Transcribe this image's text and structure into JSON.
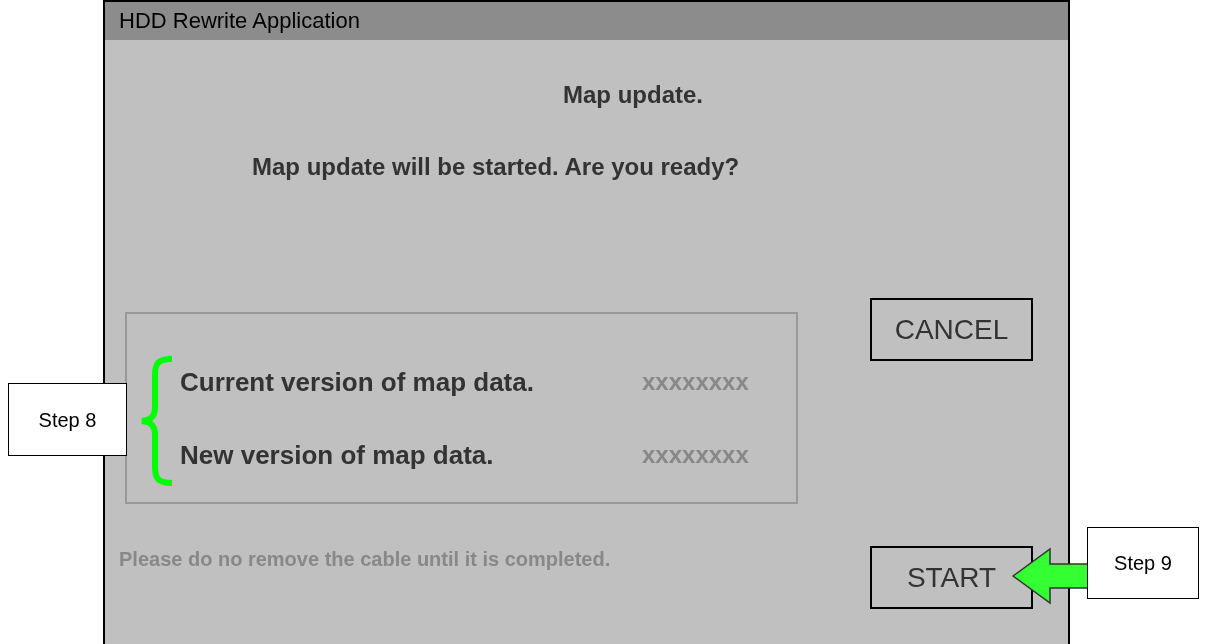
{
  "window": {
    "title": "HDD Rewrite Application"
  },
  "heading": "Map update.",
  "prompt": "Map update will be started. Are you ready?",
  "versions": [
    {
      "label": "Current version of map data.",
      "value": "xxxxxxxx"
    },
    {
      "label": "New version of map data.",
      "value": "xxxxxxxx"
    }
  ],
  "notice": "Please do no remove the cable until it is completed.",
  "buttons": [
    {
      "label": "CANCEL"
    },
    {
      "label": "START"
    }
  ],
  "callouts": [
    {
      "label": "Step 8",
      "kind": "brace"
    },
    {
      "label": "Step 9",
      "kind": "arrow"
    }
  ]
}
